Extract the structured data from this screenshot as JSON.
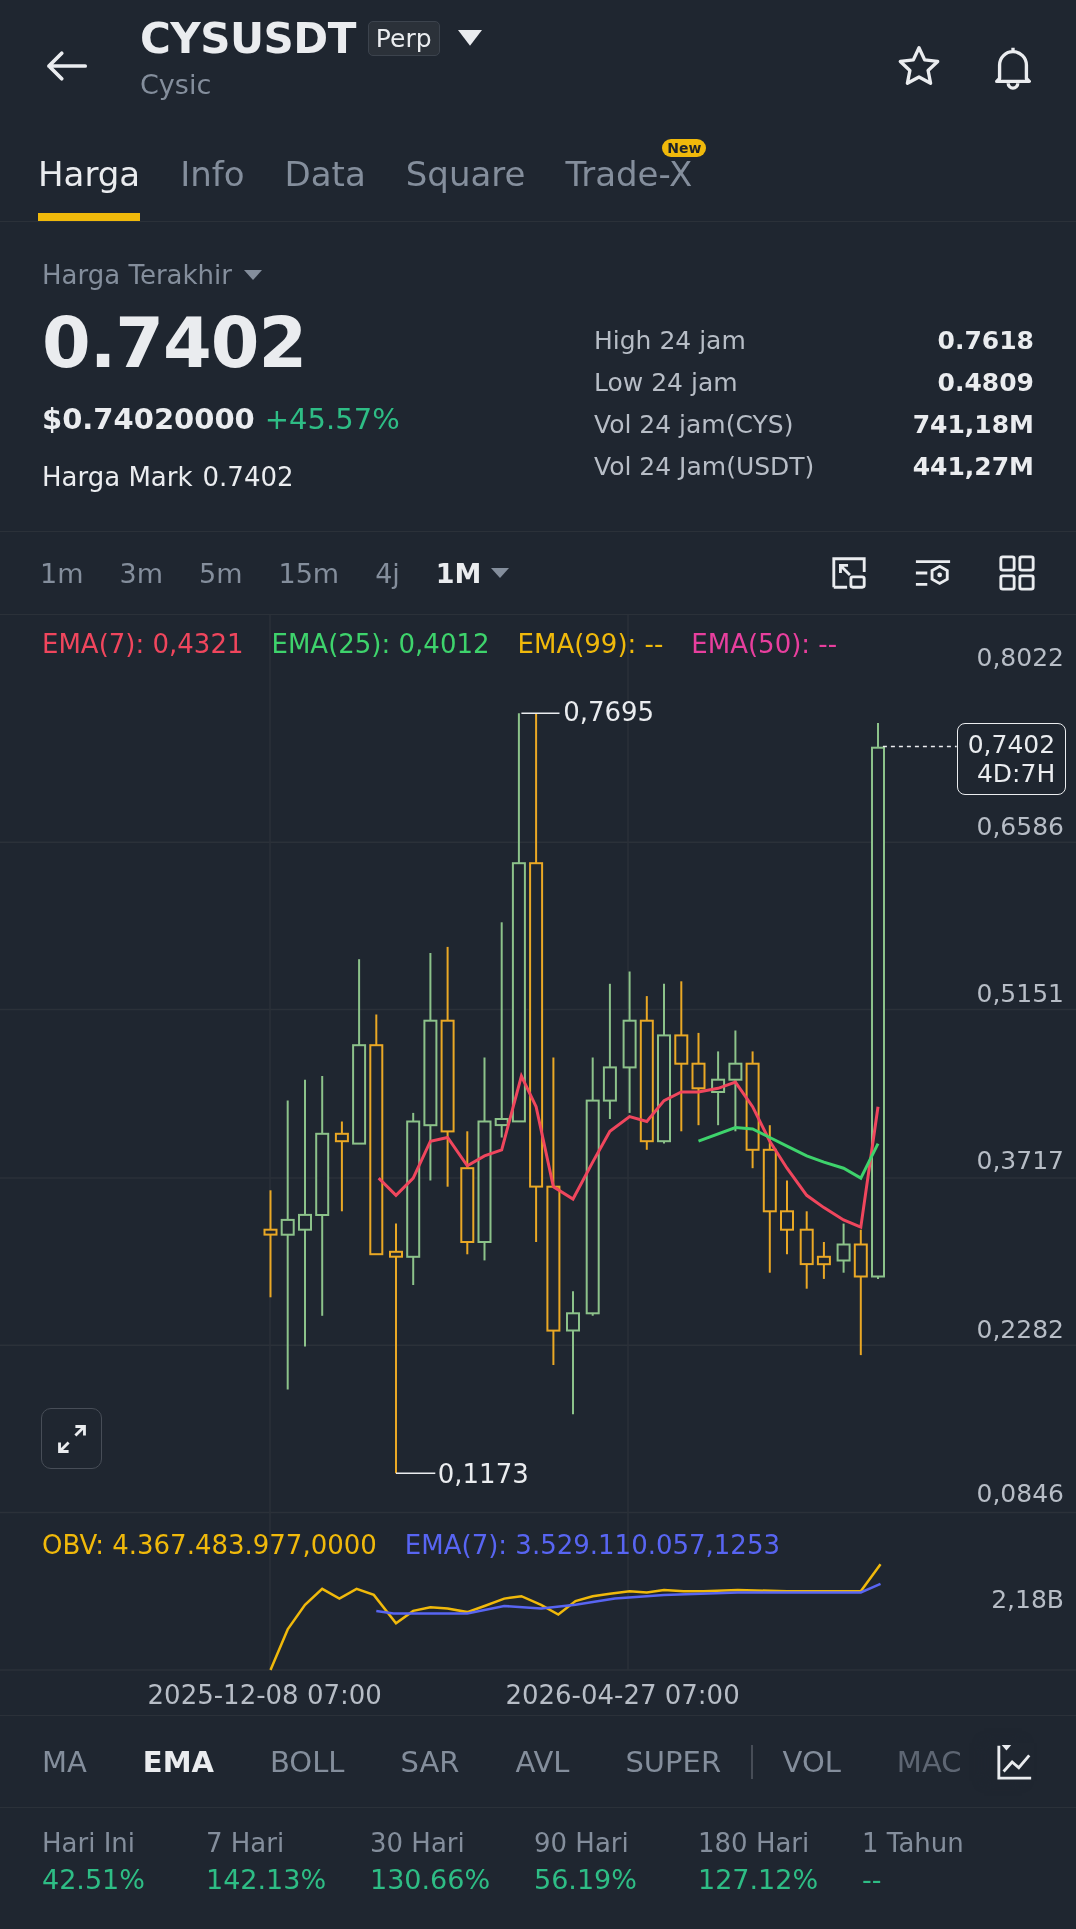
{
  "header": {
    "symbol": "CYSUSDT",
    "badge": "Perp",
    "name": "Cysic"
  },
  "tabs": [
    {
      "label": "Harga",
      "selected": true
    },
    {
      "label": "Info",
      "selected": false
    },
    {
      "label": "Data",
      "selected": false
    },
    {
      "label": "Square",
      "selected": false
    },
    {
      "label": "Trade-X",
      "selected": false,
      "badge": "New"
    }
  ],
  "price": {
    "label": "Harga Terakhir",
    "last": "0.7402",
    "usd": "$0.74020000",
    "change": "+45.57%",
    "mark_label": "Harga Mark",
    "mark": "0.7402"
  },
  "stats": [
    {
      "label": "High 24 jam",
      "value": "0.7618"
    },
    {
      "label": "Low 24 jam",
      "value": "0.4809"
    },
    {
      "label": "Vol 24 jam(CYS)",
      "value": "741,18M"
    },
    {
      "label": "Vol 24 Jam(USDT)",
      "value": "441,27M"
    }
  ],
  "intervals": [
    {
      "label": "1m",
      "selected": false
    },
    {
      "label": "3m",
      "selected": false
    },
    {
      "label": "5m",
      "selected": false
    },
    {
      "label": "15m",
      "selected": false
    },
    {
      "label": "4j",
      "selected": false
    },
    {
      "label": "1M",
      "selected": true
    }
  ],
  "chart": {
    "legend": [
      {
        "text": "EMA(7): 0,4321",
        "color": "#f0465d"
      },
      {
        "text": "EMA(25): 0,4012",
        "color": "#3ed36c"
      },
      {
        "text": "EMA(99): --",
        "color": "#f0b90b"
      },
      {
        "text": "EMA(50): --",
        "color": "#e83f9e"
      }
    ],
    "y_labels": [
      "0,8022",
      "0,6586",
      "0,5151",
      "0,3717",
      "0,2282",
      "0,0846"
    ],
    "high_label": "0,7695",
    "low_label": "0,1173",
    "price_tag": "0,7402",
    "countdown": "4D:7H"
  },
  "obv": {
    "legend": [
      {
        "text": "OBV: 4.367.483.977,0000",
        "color": "#f0b90b"
      },
      {
        "text": "EMA(7): 3.529.110.057,1253",
        "color": "#5865f2"
      }
    ],
    "y_label": "2,18B"
  },
  "dates": [
    "2025-12-08 07:00",
    "2026-04-27 07:00"
  ],
  "indicators": [
    {
      "label": "MA",
      "selected": false
    },
    {
      "label": "EMA",
      "selected": true
    },
    {
      "label": "BOLL",
      "selected": false
    },
    {
      "label": "SAR",
      "selected": false
    },
    {
      "label": "AVL",
      "selected": false
    },
    {
      "label": "SUPER",
      "selected": false
    },
    {
      "label": "VOL",
      "selected": false
    },
    {
      "label": "MAC",
      "selected": false
    }
  ],
  "returns": [
    {
      "label": "Hari Ini",
      "value": "42.51%"
    },
    {
      "label": "7 Hari",
      "value": "142.13%"
    },
    {
      "label": "30 Hari",
      "value": "130.66%"
    },
    {
      "label": "90 Hari",
      "value": "56.19%"
    },
    {
      "label": "180 Hari",
      "value": "127.12%"
    },
    {
      "label": "1 Tahun",
      "value": "--"
    }
  ]
}
